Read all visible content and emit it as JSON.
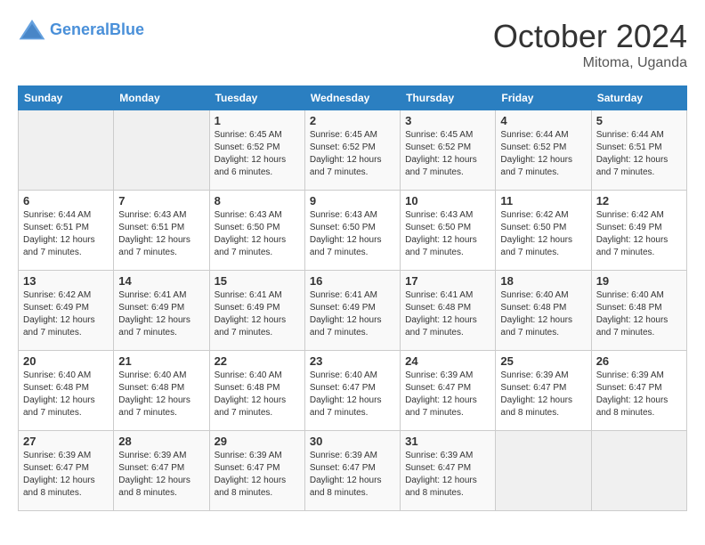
{
  "header": {
    "logo_general": "General",
    "logo_blue": "Blue",
    "month_year": "October 2024",
    "location": "Mitoma, Uganda"
  },
  "days_of_week": [
    "Sunday",
    "Monday",
    "Tuesday",
    "Wednesday",
    "Thursday",
    "Friday",
    "Saturday"
  ],
  "weeks": [
    [
      {
        "day": "",
        "info": ""
      },
      {
        "day": "",
        "info": ""
      },
      {
        "day": "1",
        "info": "Sunrise: 6:45 AM\nSunset: 6:52 PM\nDaylight: 12 hours and 6 minutes."
      },
      {
        "day": "2",
        "info": "Sunrise: 6:45 AM\nSunset: 6:52 PM\nDaylight: 12 hours and 7 minutes."
      },
      {
        "day": "3",
        "info": "Sunrise: 6:45 AM\nSunset: 6:52 PM\nDaylight: 12 hours and 7 minutes."
      },
      {
        "day": "4",
        "info": "Sunrise: 6:44 AM\nSunset: 6:52 PM\nDaylight: 12 hours and 7 minutes."
      },
      {
        "day": "5",
        "info": "Sunrise: 6:44 AM\nSunset: 6:51 PM\nDaylight: 12 hours and 7 minutes."
      }
    ],
    [
      {
        "day": "6",
        "info": "Sunrise: 6:44 AM\nSunset: 6:51 PM\nDaylight: 12 hours and 7 minutes."
      },
      {
        "day": "7",
        "info": "Sunrise: 6:43 AM\nSunset: 6:51 PM\nDaylight: 12 hours and 7 minutes."
      },
      {
        "day": "8",
        "info": "Sunrise: 6:43 AM\nSunset: 6:50 PM\nDaylight: 12 hours and 7 minutes."
      },
      {
        "day": "9",
        "info": "Sunrise: 6:43 AM\nSunset: 6:50 PM\nDaylight: 12 hours and 7 minutes."
      },
      {
        "day": "10",
        "info": "Sunrise: 6:43 AM\nSunset: 6:50 PM\nDaylight: 12 hours and 7 minutes."
      },
      {
        "day": "11",
        "info": "Sunrise: 6:42 AM\nSunset: 6:50 PM\nDaylight: 12 hours and 7 minutes."
      },
      {
        "day": "12",
        "info": "Sunrise: 6:42 AM\nSunset: 6:49 PM\nDaylight: 12 hours and 7 minutes."
      }
    ],
    [
      {
        "day": "13",
        "info": "Sunrise: 6:42 AM\nSunset: 6:49 PM\nDaylight: 12 hours and 7 minutes."
      },
      {
        "day": "14",
        "info": "Sunrise: 6:41 AM\nSunset: 6:49 PM\nDaylight: 12 hours and 7 minutes."
      },
      {
        "day": "15",
        "info": "Sunrise: 6:41 AM\nSunset: 6:49 PM\nDaylight: 12 hours and 7 minutes."
      },
      {
        "day": "16",
        "info": "Sunrise: 6:41 AM\nSunset: 6:49 PM\nDaylight: 12 hours and 7 minutes."
      },
      {
        "day": "17",
        "info": "Sunrise: 6:41 AM\nSunset: 6:48 PM\nDaylight: 12 hours and 7 minutes."
      },
      {
        "day": "18",
        "info": "Sunrise: 6:40 AM\nSunset: 6:48 PM\nDaylight: 12 hours and 7 minutes."
      },
      {
        "day": "19",
        "info": "Sunrise: 6:40 AM\nSunset: 6:48 PM\nDaylight: 12 hours and 7 minutes."
      }
    ],
    [
      {
        "day": "20",
        "info": "Sunrise: 6:40 AM\nSunset: 6:48 PM\nDaylight: 12 hours and 7 minutes."
      },
      {
        "day": "21",
        "info": "Sunrise: 6:40 AM\nSunset: 6:48 PM\nDaylight: 12 hours and 7 minutes."
      },
      {
        "day": "22",
        "info": "Sunrise: 6:40 AM\nSunset: 6:48 PM\nDaylight: 12 hours and 7 minutes."
      },
      {
        "day": "23",
        "info": "Sunrise: 6:40 AM\nSunset: 6:47 PM\nDaylight: 12 hours and 7 minutes."
      },
      {
        "day": "24",
        "info": "Sunrise: 6:39 AM\nSunset: 6:47 PM\nDaylight: 12 hours and 7 minutes."
      },
      {
        "day": "25",
        "info": "Sunrise: 6:39 AM\nSunset: 6:47 PM\nDaylight: 12 hours and 8 minutes."
      },
      {
        "day": "26",
        "info": "Sunrise: 6:39 AM\nSunset: 6:47 PM\nDaylight: 12 hours and 8 minutes."
      }
    ],
    [
      {
        "day": "27",
        "info": "Sunrise: 6:39 AM\nSunset: 6:47 PM\nDaylight: 12 hours and 8 minutes."
      },
      {
        "day": "28",
        "info": "Sunrise: 6:39 AM\nSunset: 6:47 PM\nDaylight: 12 hours and 8 minutes."
      },
      {
        "day": "29",
        "info": "Sunrise: 6:39 AM\nSunset: 6:47 PM\nDaylight: 12 hours and 8 minutes."
      },
      {
        "day": "30",
        "info": "Sunrise: 6:39 AM\nSunset: 6:47 PM\nDaylight: 12 hours and 8 minutes."
      },
      {
        "day": "31",
        "info": "Sunrise: 6:39 AM\nSunset: 6:47 PM\nDaylight: 12 hours and 8 minutes."
      },
      {
        "day": "",
        "info": ""
      },
      {
        "day": "",
        "info": ""
      }
    ]
  ]
}
